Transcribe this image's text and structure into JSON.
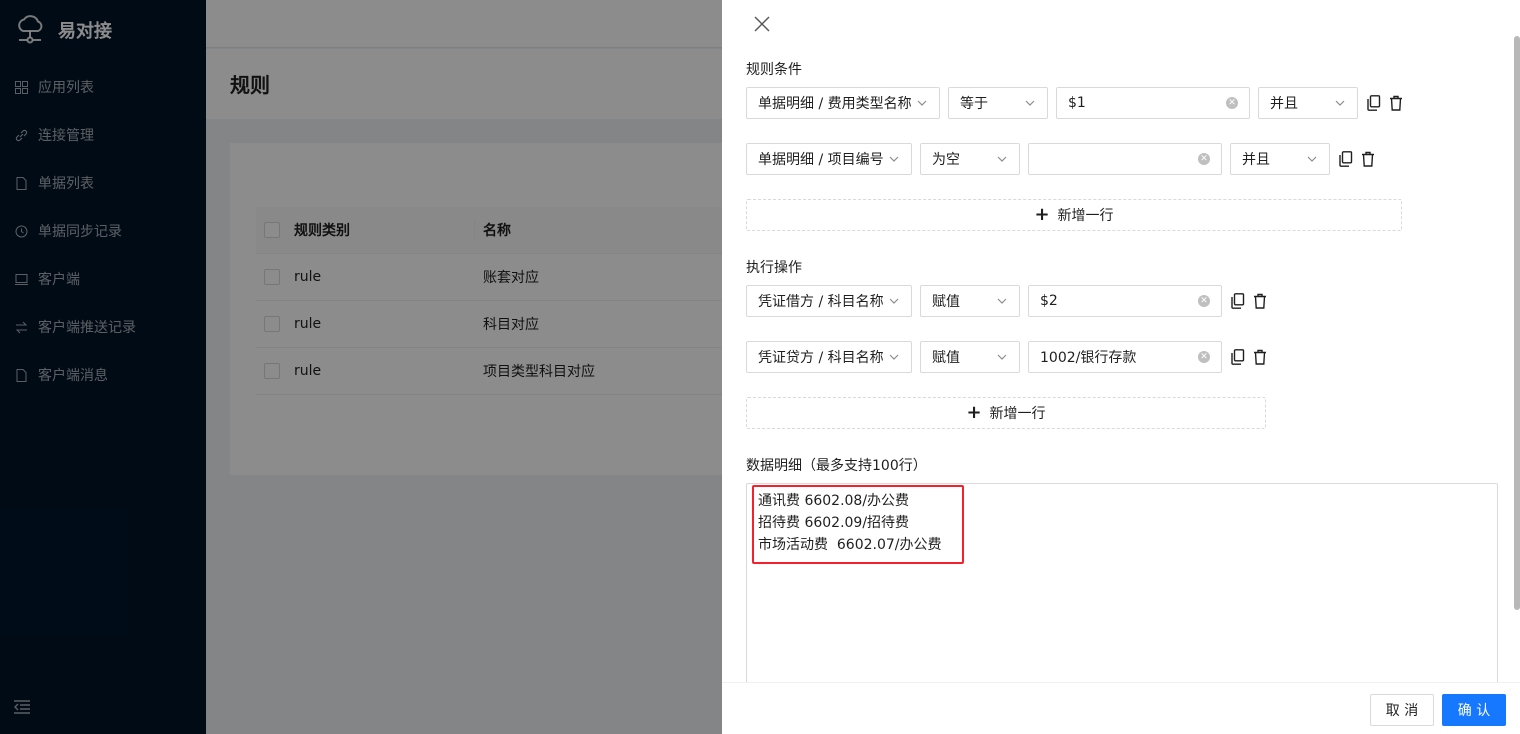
{
  "app": {
    "brand": "易对接"
  },
  "sidebar": {
    "items": [
      {
        "label": "应用列表",
        "icon": "grid-icon"
      },
      {
        "label": "连接管理",
        "icon": "link-icon"
      },
      {
        "label": "单据列表",
        "icon": "file-icon"
      },
      {
        "label": "单据同步记录",
        "icon": "history-icon"
      },
      {
        "label": "客户端",
        "icon": "laptop-icon"
      },
      {
        "label": "客户端推送记录",
        "icon": "swap-icon"
      },
      {
        "label": "客户端消息",
        "icon": "file-icon"
      }
    ]
  },
  "page": {
    "title": "规则",
    "table": {
      "headers": [
        "规则类别",
        "名称"
      ],
      "rows": [
        [
          "rule",
          "账套对应"
        ],
        [
          "rule",
          "科目对应"
        ],
        [
          "rule",
          "项目类型科目对应"
        ]
      ]
    }
  },
  "drawer": {
    "conditions_title": "规则条件",
    "conditions": [
      {
        "field": "单据明细 / 费用类型名称",
        "operator": "等于",
        "value": "$1",
        "logic": "并且"
      },
      {
        "field": "单据明细 / 项目编号",
        "operator": "为空",
        "value": "",
        "logic": "并且"
      }
    ],
    "add_row_label": "新增一行",
    "actions_title": "执行操作",
    "actions": [
      {
        "field": "凭证借方 / 科目名称",
        "operator": "赋值",
        "value": "$2"
      },
      {
        "field": "凭证贷方 / 科目名称",
        "operator": "赋值",
        "value": "1002/银行存款"
      }
    ],
    "details_title": "数据明细（最多支持100行）",
    "details_text": "通讯费 6602.08/办公费\n招待费 6602.09/招待费\n市场活动费  6602.07/办公费",
    "cancel_label": "取 消",
    "ok_label": "确 认"
  },
  "colors": {
    "sidebar_bg": "#001529",
    "primary": "#1677ff",
    "highlight": "#f5222d"
  }
}
